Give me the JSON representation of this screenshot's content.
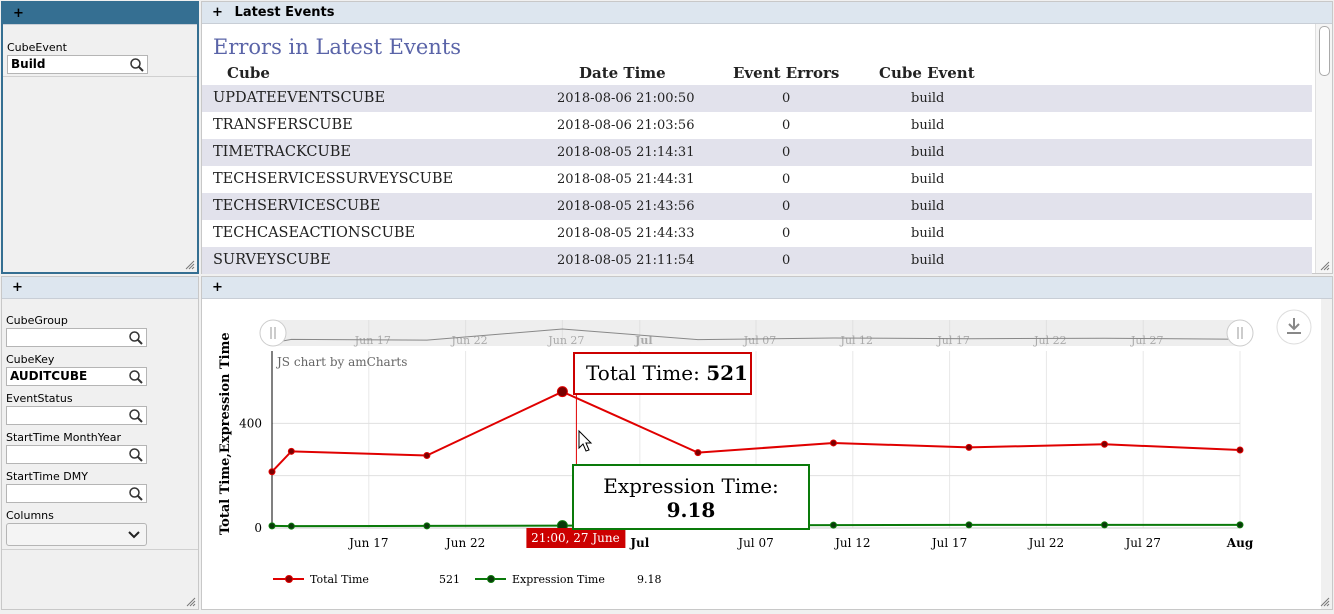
{
  "left_top": {
    "header_icon": "plus-icon",
    "filter": {
      "label": "CubeEvent",
      "value": "Build"
    }
  },
  "left_bottom": {
    "header_icon": "plus-icon",
    "filters": [
      {
        "label": "CubeGroup",
        "value": ""
      },
      {
        "label": "CubeKey",
        "value": "AUDITCUBE"
      },
      {
        "label": "EventStatus",
        "value": ""
      },
      {
        "label": "StartTime MonthYear",
        "value": ""
      },
      {
        "label": "StartTime DMY",
        "value": ""
      }
    ],
    "columns_label": "Columns",
    "columns_value": ""
  },
  "events_pane": {
    "header_title": "Latest Events",
    "table_title": "Errors in Latest Events",
    "columns": [
      "Cube",
      "Date Time",
      "Event Errors",
      "Cube Event"
    ],
    "rows": [
      [
        "UPDATEEVENTSCUBE",
        "2018-08-06 21:00:50",
        "0",
        "build"
      ],
      [
        "TRANSFERSCUBE",
        "2018-08-06 21:03:56",
        "0",
        "build"
      ],
      [
        "TIMETRACKCUBE",
        "2018-08-05 21:14:31",
        "0",
        "build"
      ],
      [
        "TECHSERVICESSURVEYSCUBE",
        "2018-08-05 21:44:31",
        "0",
        "build"
      ],
      [
        "TECHSERVICESCUBE",
        "2018-08-05 21:43:56",
        "0",
        "build"
      ],
      [
        "TECHCASEACTIONSCUBE",
        "2018-08-05 21:44:33",
        "0",
        "build"
      ],
      [
        "SURVEYSCUBE",
        "2018-08-05 21:11:54",
        "0",
        "build"
      ]
    ],
    "row_alt_color": "#e2e2ec"
  },
  "chart_pane": {
    "header_icon": "plus-icon",
    "export_icon": "download-icon",
    "credit": "JS chart by amCharts",
    "cursor_label": "21:00, 27 June",
    "tooltip_total_label": "Total Time:",
    "tooltip_total_value": "521",
    "tooltip_expr_label": "Expression Time:",
    "tooltip_expr_value": "9.18",
    "legend_total_value": "521",
    "legend_expr_value": "9.18"
  },
  "chart_data": {
    "type": "line",
    "ylabel": "Total Time,Expression Time",
    "ylim": [
      0,
      600
    ],
    "yticks": [
      "0",
      "400"
    ],
    "x_tick_labels": [
      {
        "date": "2018-06-17",
        "label": "Jun 17",
        "bold": false
      },
      {
        "date": "2018-06-22",
        "label": "Jun 22",
        "bold": false
      },
      {
        "date": "2018-07-01",
        "label": "Jul",
        "bold": true
      },
      {
        "date": "2018-07-07",
        "label": "Jul 07",
        "bold": false
      },
      {
        "date": "2018-07-12",
        "label": "Jul 12",
        "bold": false
      },
      {
        "date": "2018-07-17",
        "label": "Jul 17",
        "bold": false
      },
      {
        "date": "2018-07-22",
        "label": "Jul 22",
        "bold": false
      },
      {
        "date": "2018-07-27",
        "label": "Jul 27",
        "bold": false
      },
      {
        "date": "2018-08-01",
        "label": "Aug",
        "bold": true
      }
    ],
    "scrollbar_labels": [
      {
        "date": "2018-06-17",
        "label": "Jun 17",
        "bold": false
      },
      {
        "date": "2018-06-22",
        "label": "Jun 22",
        "bold": false
      },
      {
        "date": "2018-06-27",
        "label": "Jun 27",
        "bold": false
      },
      {
        "date": "2018-07-01",
        "label": "Jul",
        "bold": true
      },
      {
        "date": "2018-07-07",
        "label": "Jul 07",
        "bold": false
      },
      {
        "date": "2018-07-12",
        "label": "Jul 12",
        "bold": false
      },
      {
        "date": "2018-07-17",
        "label": "Jul 17",
        "bold": false
      },
      {
        "date": "2018-07-22",
        "label": "Jul 22",
        "bold": false
      },
      {
        "date": "2018-07-27",
        "label": "Jul 27",
        "bold": false
      }
    ],
    "x_range": [
      "2018-06-12",
      "2018-08-01"
    ],
    "series": [
      {
        "name": "Total Time",
        "color": "#e00000",
        "points": [
          {
            "x": "2018-06-12",
            "y": 215
          },
          {
            "x": "2018-06-13",
            "y": 293
          },
          {
            "x": "2018-06-20",
            "y": 277
          },
          {
            "x": "2018-06-27",
            "y": 521
          },
          {
            "x": "2018-07-04",
            "y": 288
          },
          {
            "x": "2018-07-11",
            "y": 325
          },
          {
            "x": "2018-07-18",
            "y": 308
          },
          {
            "x": "2018-07-25",
            "y": 320
          },
          {
            "x": "2018-08-01",
            "y": 298
          }
        ]
      },
      {
        "name": "Expression Time",
        "color": "#0a7a0a",
        "points": [
          {
            "x": "2018-06-12",
            "y": 8
          },
          {
            "x": "2018-06-13",
            "y": 7
          },
          {
            "x": "2018-06-20",
            "y": 8
          },
          {
            "x": "2018-06-27",
            "y": 9.18
          },
          {
            "x": "2018-07-04",
            "y": 10
          },
          {
            "x": "2018-07-11",
            "y": 11
          },
          {
            "x": "2018-07-18",
            "y": 12
          },
          {
            "x": "2018-07-25",
            "y": 12
          },
          {
            "x": "2018-08-01",
            "y": 12
          }
        ]
      }
    ],
    "grid": true,
    "legend_position": "bottom"
  }
}
